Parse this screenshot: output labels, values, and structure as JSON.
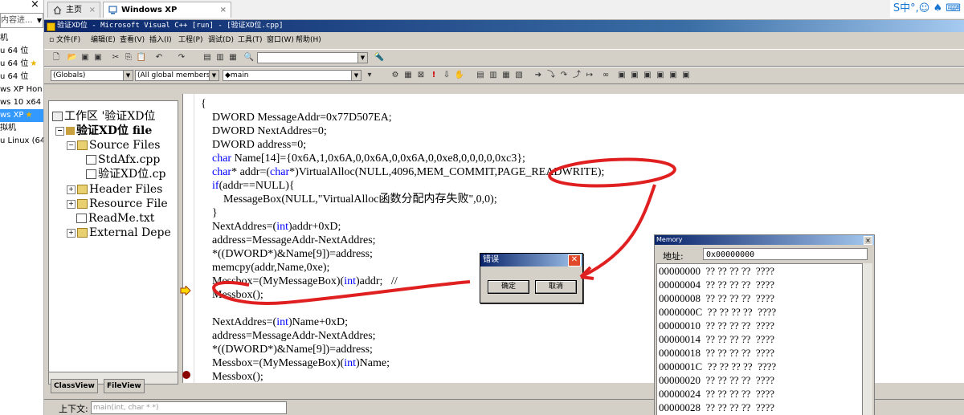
{
  "library": {
    "close": "×",
    "search_text": "内容进...",
    "items": [
      {
        "label": "机",
        "star": false,
        "selected": false
      },
      {
        "label": "u 64 位",
        "star": false,
        "selected": false
      },
      {
        "label": "u 64 位",
        "star": true,
        "selected": false
      },
      {
        "label": "u 64 位",
        "star": false,
        "selected": false
      },
      {
        "label": "ws XP Hon",
        "star": false,
        "selected": false
      },
      {
        "label": "ws 10 x64",
        "star": false,
        "selected": false
      },
      {
        "label": "ws XP",
        "star": true,
        "selected": true
      },
      {
        "label": "拟机",
        "star": false,
        "selected": false
      },
      {
        "label": "u Linux (64",
        "star": false,
        "selected": false
      }
    ]
  },
  "vm_tabs": [
    {
      "label": "主页",
      "active": false
    },
    {
      "label": "Windows XP Professional",
      "active": true
    }
  ],
  "ime_bar": "S中°,☺ ♠ ⌨",
  "vc": {
    "title": "验证XD位 - Microsoft Visual C++ [run] - [验证XD位.cpp]",
    "menu": [
      "文件(F)",
      "编辑(E)",
      "查看(V)",
      "插入(I)",
      "工程(P)",
      "调试(D)",
      "工具(T)",
      "窗口(W)",
      "帮助(H)"
    ],
    "combo_globals": "(Globals)",
    "combo_members": "(All global members",
    "combo_main": "◆main",
    "workspace": {
      "title": "工作区 '验证XD位",
      "project": "验证XD位 file",
      "source_files": "Source Files",
      "stdafx": "StdAfx.cpp",
      "main_cpp": "验证XD位.cp",
      "header_files": "Header Files",
      "resource_files": "Resource File",
      "readme": "ReadMe.txt",
      "external": "External Depe"
    },
    "ws_tabs": [
      "ClassView",
      "FileView"
    ],
    "code": [
      "{",
      "    DWORD MessageAddr=0x77D507EA;",
      "    DWORD NextAddres=0;",
      "    DWORD address=0;",
      "    char Name[14]={0x6A,1,0x6A,0,0x6A,0,0x6A,0,0xe8,0,0,0,0,0xc3};",
      "    char* addr=(char*)VirtualAlloc(NULL,4096,MEM_COMMIT,PAGE_READWRITE);",
      "    if(addr==NULL){",
      "        MessageBox(NULL,\"VirtualAlloc函数分配内存失败\",0,0);",
      "    }",
      "    NextAddres=(int)addr+0xD;",
      "    address=MessageAddr-NextAddres;",
      "    *((DWORD*)&Name[9])=address;",
      "    memcpy(addr,Name,0xe);",
      "    Messbox=(MyMessageBox)(int)addr;   //",
      "    Messbox();",
      "",
      "    NextAddres=(int)Name+0xD;",
      "    address=MessageAddr-NextAddres;",
      "    *((DWORD*)&Name[9])=address;",
      "    Messbox=(MyMessageBox)(int)Name;",
      "    Messbox();"
    ],
    "output_label": "上下文:",
    "output_context": "main(int, char * *)"
  },
  "error_dialog": {
    "title": "错误",
    "ok": "确定",
    "cancel": "取消"
  },
  "memory": {
    "title": "Memory",
    "addr_label": "地址:",
    "addr_value": "0x00000000",
    "rows": [
      "00000000  ?? ?? ?? ??  ????",
      "00000004  ?? ?? ?? ??  ????",
      "00000008  ?? ?? ?? ??  ????",
      "0000000C  ?? ?? ?? ??  ????",
      "00000010  ?? ?? ?? ??  ????",
      "00000014  ?? ?? ?? ??  ????",
      "00000018  ?? ?? ?? ??  ????",
      "0000001C  ?? ?? ?? ??  ????",
      "00000020  ?? ?? ?? ??  ????",
      "00000024  ?? ?? ?? ??  ????",
      "00000028  ?? ?? ?? ??  ????"
    ]
  },
  "colors": {
    "keyword": "#0000ff",
    "annotation": "#e02020",
    "xp_title": "#0a246a"
  }
}
